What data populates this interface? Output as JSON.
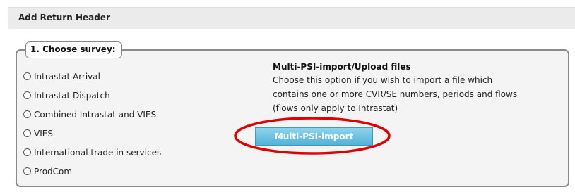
{
  "header": {
    "title": "Add Return Header"
  },
  "survey": {
    "legend": "1. Choose survey:",
    "options": [
      {
        "label": "Intrastat Arrival",
        "selected": false
      },
      {
        "label": "Intrastat Dispatch",
        "selected": false
      },
      {
        "label": "Combined Intrastat and VIES",
        "selected": false
      },
      {
        "label": "VIES",
        "selected": false
      },
      {
        "label": "International trade in services",
        "selected": false
      },
      {
        "label": "ProdCom",
        "selected": false
      }
    ]
  },
  "multi_psi": {
    "title": "Multi-PSI-import/Upload files",
    "description_lines": [
      "Choose this option if you wish to import a file which",
      "contains one or more CVR/SE numbers, periods and flows",
      "(flows only apply to Intrastat)"
    ],
    "button_label": "Multi-PSI-import",
    "highlight_color": "#e00000"
  },
  "colors": {
    "button_top": "#8fd4ec",
    "button_bottom": "#52b2d9",
    "header_bg": "#ebebeb",
    "box_border": "#8a8a8a"
  }
}
